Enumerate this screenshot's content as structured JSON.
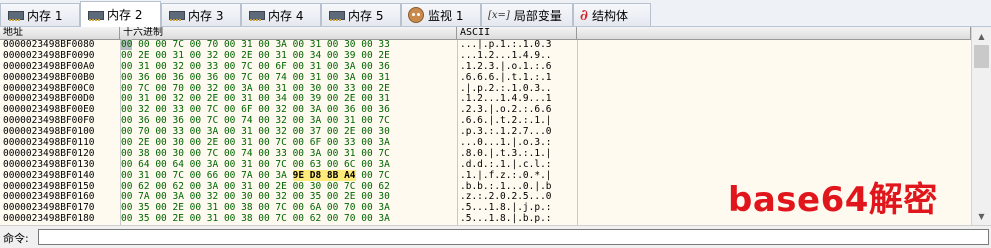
{
  "tabs": [
    {
      "label": "内存 1",
      "icon": "memory-chip-icon",
      "active": false
    },
    {
      "label": "内存 2",
      "icon": "memory-chip-icon",
      "active": true
    },
    {
      "label": "内存 3",
      "icon": "memory-chip-icon",
      "active": false
    },
    {
      "label": "内存 4",
      "icon": "memory-chip-icon",
      "active": false
    },
    {
      "label": "内存 5",
      "icon": "memory-chip-icon",
      "active": false
    },
    {
      "label": "监视 1",
      "icon": "watch-icon",
      "active": false
    },
    {
      "label": "局部变量",
      "icon_text": "[x=]",
      "icon": "local-variables-icon",
      "active": false
    },
    {
      "label": "结构体",
      "icon": "struct-icon",
      "active": false
    }
  ],
  "dump": {
    "headers": {
      "address": "地址",
      "hex": "十六进制",
      "ascii": "ASCII"
    },
    "rows": [
      {
        "address": "0000023498BF0080",
        "hex": "00 00 00 7C 00 70 00 31 00 3A 00 31 00 30 00 33",
        "ascii": "...|.p.1.:.1.0.3"
      },
      {
        "address": "0000023498BF0090",
        "hex": "00 2E 00 31 00 32 00 2E 00 31 00 34 00 39 00 2E",
        "ascii": "...1.2...1.4.9.."
      },
      {
        "address": "0000023498BF00A0",
        "hex": "00 31 00 32 00 33 00 7C 00 6F 00 31 00 3A 00 36",
        "ascii": ".1.2.3.|.o.1.:.6"
      },
      {
        "address": "0000023498BF00B0",
        "hex": "00 36 00 36 00 36 00 7C 00 74 00 31 00 3A 00 31",
        "ascii": ".6.6.6.|.t.1.:.1"
      },
      {
        "address": "0000023498BF00C0",
        "hex": "00 7C 00 70 00 32 00 3A 00 31 00 30 00 33 00 2E",
        "ascii": ".|.p.2.:.1.0.3.."
      },
      {
        "address": "0000023498BF00D0",
        "hex": "00 31 00 32 00 2E 00 31 00 34 00 39 00 2E 00 31",
        "ascii": ".1.2...1.4.9...1"
      },
      {
        "address": "0000023498BF00E0",
        "hex": "00 32 00 33 00 7C 00 6F 00 32 00 3A 00 36 00 36",
        "ascii": ".2.3.|.o.2.:.6.6"
      },
      {
        "address": "0000023498BF00F0",
        "hex": "00 36 00 36 00 7C 00 74 00 32 00 3A 00 31 00 7C",
        "ascii": ".6.6.|.t.2.:.1.|"
      },
      {
        "address": "0000023498BF0100",
        "hex": "00 70 00 33 00 3A 00 31 00 32 00 37 00 2E 00 30",
        "ascii": ".p.3.:.1.2.7...0"
      },
      {
        "address": "0000023498BF0110",
        "hex": "00 2E 00 30 00 2E 00 31 00 7C 00 6F 00 33 00 3A",
        "ascii": "...0...1.|.o.3.:"
      },
      {
        "address": "0000023498BF0120",
        "hex": "00 38 00 30 00 7C 00 74 00 33 00 3A 00 31 00 7C",
        "ascii": ".8.0.|.t.3.:.1.|"
      },
      {
        "address": "0000023498BF0130",
        "hex": "00 64 00 64 00 3A 00 31 00 7C 00 63 00 6C 00 3A",
        "ascii": ".d.d.:.1.|.c.l.:"
      },
      {
        "address": "0000023498BF0140",
        "hex": "00 31 00 7C 00 66 00 7A 00 3A 9E D8 8B A4 00 7C",
        "ascii": ".1.|.f.z.:.0.*.|"
      },
      {
        "address": "0000023498BF0150",
        "hex": "00 62 00 62 00 3A 00 31 00 2E 00 30 00 7C 00 62",
        "ascii": ".b.b.:.1...0.|.b"
      },
      {
        "address": "0000023498BF0160",
        "hex": "00 7A 00 3A 00 32 00 30 00 32 00 35 00 2E 00 30",
        "ascii": ".z.:.2.0.2.5...0"
      },
      {
        "address": "0000023498BF0170",
        "hex": "00 35 00 2E 00 31 00 38 00 7C 00 6A 00 70 00 3A",
        "ascii": ".5...1.8.|.j.p.:"
      },
      {
        "address": "0000023498BF0180",
        "hex": "00 35 00 2E 00 31 00 38 00 7C 00 62 00 70 00 3A",
        "ascii": ".5...1.8.|.b.p.:"
      }
    ]
  },
  "overlay_text": "base64解密",
  "command": {
    "label": "命令:",
    "value": ""
  },
  "colors": {
    "hex_text": "#006400",
    "overlay": "#e1161c",
    "panel_bg": "#fffaf0"
  }
}
